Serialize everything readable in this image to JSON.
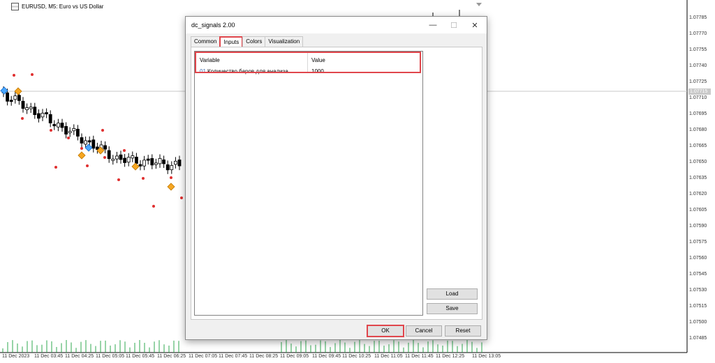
{
  "chart": {
    "title": "EURUSD, M5:  Euro vs US Dollar",
    "current_price": "1.07715",
    "price_labels": [
      "1.07785",
      "1.07770",
      "1.07755",
      "1.07740",
      "1.07725",
      "1.07710",
      "1.07695",
      "1.07680",
      "1.07665",
      "1.07650",
      "1.07635",
      "1.07620",
      "1.07605",
      "1.07590",
      "1.07575",
      "1.07560",
      "1.07545",
      "1.07530",
      "1.07515",
      "1.07500",
      "1.07485"
    ],
    "time_labels": [
      "11 Dec 2023",
      "11 Dec 03:45",
      "11 Dec 04:25",
      "11 Dec 05:05",
      "11 Dec 05:45",
      "11 Dec 06:25",
      "11 Dec 07:05",
      "11 Dec 07:45",
      "11 Dec 08:25",
      "11 Dec 09:05",
      "11 Dec 09:45",
      "11 Dec 10:25",
      "11 Dec 11:05",
      "11 Dec 11:45",
      "11 Dec 12:25",
      "11 Dec 13:05"
    ],
    "colors": {
      "bull": "#ffffff",
      "bear": "#000000",
      "volume": "#2fa84f",
      "signal_dot": "#e03030",
      "signal_diamond": "#f5a623",
      "grid_line": "#c0c0c0"
    }
  },
  "dialog": {
    "title": "dc_signals 2.00",
    "tabs": [
      "Common",
      "Inputs",
      "Colors",
      "Visualization"
    ],
    "active_tab": "Inputs",
    "table": {
      "headers": {
        "variable": "Variable",
        "value": "Value"
      },
      "rows": [
        {
          "num": "01",
          "name": "Количество баров для анализа",
          "value": "1000"
        }
      ]
    },
    "buttons": {
      "load": "Load",
      "save": "Save",
      "ok": "OK",
      "cancel": "Cancel",
      "reset": "Reset"
    }
  }
}
